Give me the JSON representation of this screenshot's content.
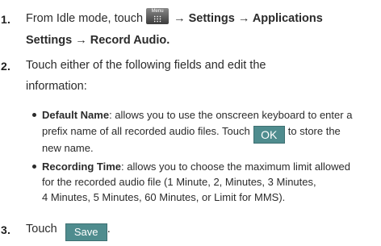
{
  "steps": [
    {
      "number": "1.",
      "line1_prefix": "From Idle mode, touch",
      "menu_key_label": "Menu",
      "line1_suffix": "→ Settings → Applications",
      "line2": "Settings → Record Audio."
    },
    {
      "number": "2.",
      "line1": "Touch either of the following fields and edit the",
      "line2": "information:",
      "bullets": [
        {
          "term": "Default Name",
          "line1_rest": ": allows you to use the onscreen keyboard to enter a",
          "line2_prefix": "prefix name of all recorded audio files. Touch",
          "button_label": "OK",
          "line2_suffix": "to store the",
          "line3": "new name."
        },
        {
          "term": "Recording Time",
          "line1_rest": ": allows you to choose the maximum limit allowed",
          "line2": "for the recorded audio file (1 Minute, 2, Minutes, 3 Minutes,",
          "line3": "4 Minutes, 5 Minutes, 60 Minutes, or Limit for MMS)."
        }
      ]
    },
    {
      "number": "3.",
      "text": "Touch",
      "button_label": "Save",
      "suffix": "."
    }
  ],
  "colors": {
    "button_bg": "#4f8c8e",
    "text": "#2b2b2b"
  }
}
